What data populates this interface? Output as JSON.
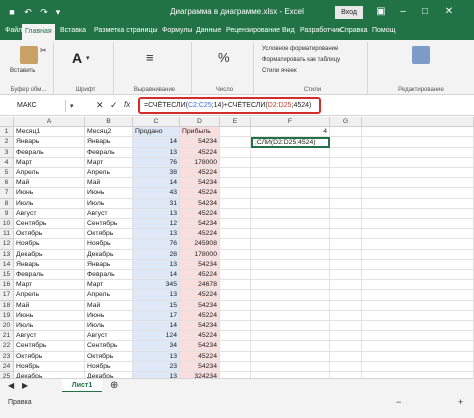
{
  "titlebar": {
    "title": "Диаграмма в диаграмме.xlsx - Excel",
    "login": "Вход"
  },
  "tabs": [
    "Файл",
    "Главная",
    "Вставка",
    "Разметка страницы",
    "Формулы",
    "Данные",
    "Рецензирование",
    "Вид",
    "Разработчик",
    "Справка",
    "Помощ"
  ],
  "active_tab": 1,
  "ribbon": {
    "paste_label": "Вставить",
    "clipboard_label": "Буфер обм...",
    "font_label": "Шрифт",
    "align_label": "Выравнивание",
    "number_label": "Число",
    "styles_label": "Стили",
    "editing_label": "Редактирование",
    "percent_label": "%",
    "cond_format": "Условное форматирование",
    "format_table": "Форматировать как таблицу",
    "cell_styles": "Стили ячеек"
  },
  "formula_bar": {
    "name_box": "МАКС",
    "prefix": "=СЧЁТЕСЛИ(",
    "range1": "C2:C25",
    "mid": ";14)+СЧЁТЕСЛИ(",
    "range2": "D2:D25",
    "suffix": ";4524)"
  },
  "columns": [
    "A",
    "B",
    "C",
    "D",
    "E",
    "F",
    "G"
  ],
  "header_row": [
    "Месяц1",
    "Месяц2",
    "Продано",
    "Прибыль",
    "",
    "4",
    ""
  ],
  "edit_cell": ";СЛИ(D2:D25;4524)",
  "rows": [
    [
      "Январь",
      "Январь",
      "14",
      "54234"
    ],
    [
      "Февраль",
      "Февраль",
      "13",
      "45224"
    ],
    [
      "Март",
      "Март",
      "76",
      "178000"
    ],
    [
      "Апрель",
      "Апрель",
      "38",
      "45224"
    ],
    [
      "Май",
      "Май",
      "14",
      "54234"
    ],
    [
      "Июнь",
      "Июнь",
      "43",
      "45224"
    ],
    [
      "Июль",
      "Июль",
      "31",
      "54234"
    ],
    [
      "Август",
      "Август",
      "13",
      "45224"
    ],
    [
      "Сентябрь",
      "Сентябрь",
      "12",
      "54234"
    ],
    [
      "Октябрь",
      "Октябрь",
      "13",
      "45224"
    ],
    [
      "Ноябрь",
      "Ноябрь",
      "76",
      "245908"
    ],
    [
      "Декабрь",
      "Декабрь",
      "28",
      "178000"
    ],
    [
      "Январь",
      "Январь",
      "13",
      "54234"
    ],
    [
      "Февраль",
      "Февраль",
      "14",
      "45224"
    ],
    [
      "Март",
      "Март",
      "345",
      "24678"
    ],
    [
      "Апрель",
      "Апрель",
      "13",
      "45224"
    ],
    [
      "Май",
      "Май",
      "15",
      "54234"
    ],
    [
      "Июнь",
      "Июнь",
      "17",
      "45224"
    ],
    [
      "Июль",
      "Июль",
      "14",
      "54234"
    ],
    [
      "Август",
      "Август",
      "124",
      "45224"
    ],
    [
      "Сентябрь",
      "Сентябрь",
      "34",
      "54234"
    ],
    [
      "Октябрь",
      "Октябрь",
      "13",
      "45224"
    ],
    [
      "Ноябрь",
      "Ноябрь",
      "23",
      "54234"
    ],
    [
      "Декабрь",
      "Декабрь",
      "13",
      "324234"
    ]
  ],
  "sheet_tab": "Лист1",
  "status": "Правка",
  "colors": {
    "accent": "#217346",
    "formula_border": "#d62b2b",
    "range1": "#3b6fd8",
    "range2": "#c0392b"
  }
}
